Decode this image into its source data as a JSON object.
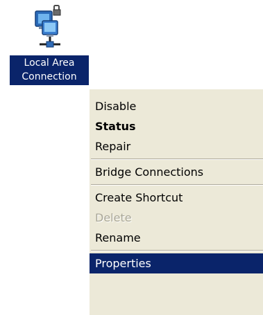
{
  "desktop_icon": {
    "name": "local-area-connection",
    "label_line1": "Local Area",
    "label_line2": "Connection",
    "icon": "network-connection-icon"
  },
  "context_menu": {
    "items": [
      {
        "label": "Disable",
        "style": "normal"
      },
      {
        "label": "Status",
        "style": "bold"
      },
      {
        "label": "Repair",
        "style": "normal"
      },
      {
        "separator": true
      },
      {
        "label": "Bridge Connections",
        "style": "normal"
      },
      {
        "separator": true
      },
      {
        "label": "Create Shortcut",
        "style": "normal"
      },
      {
        "label": "Delete",
        "style": "disabled"
      },
      {
        "label": "Rename",
        "style": "normal"
      },
      {
        "separator": true
      },
      {
        "label": "Properties",
        "style": "selected"
      }
    ]
  },
  "colors": {
    "selection": "#0a246a",
    "menu_bg": "#ece9d8",
    "disabled_text": "#a9a797"
  }
}
